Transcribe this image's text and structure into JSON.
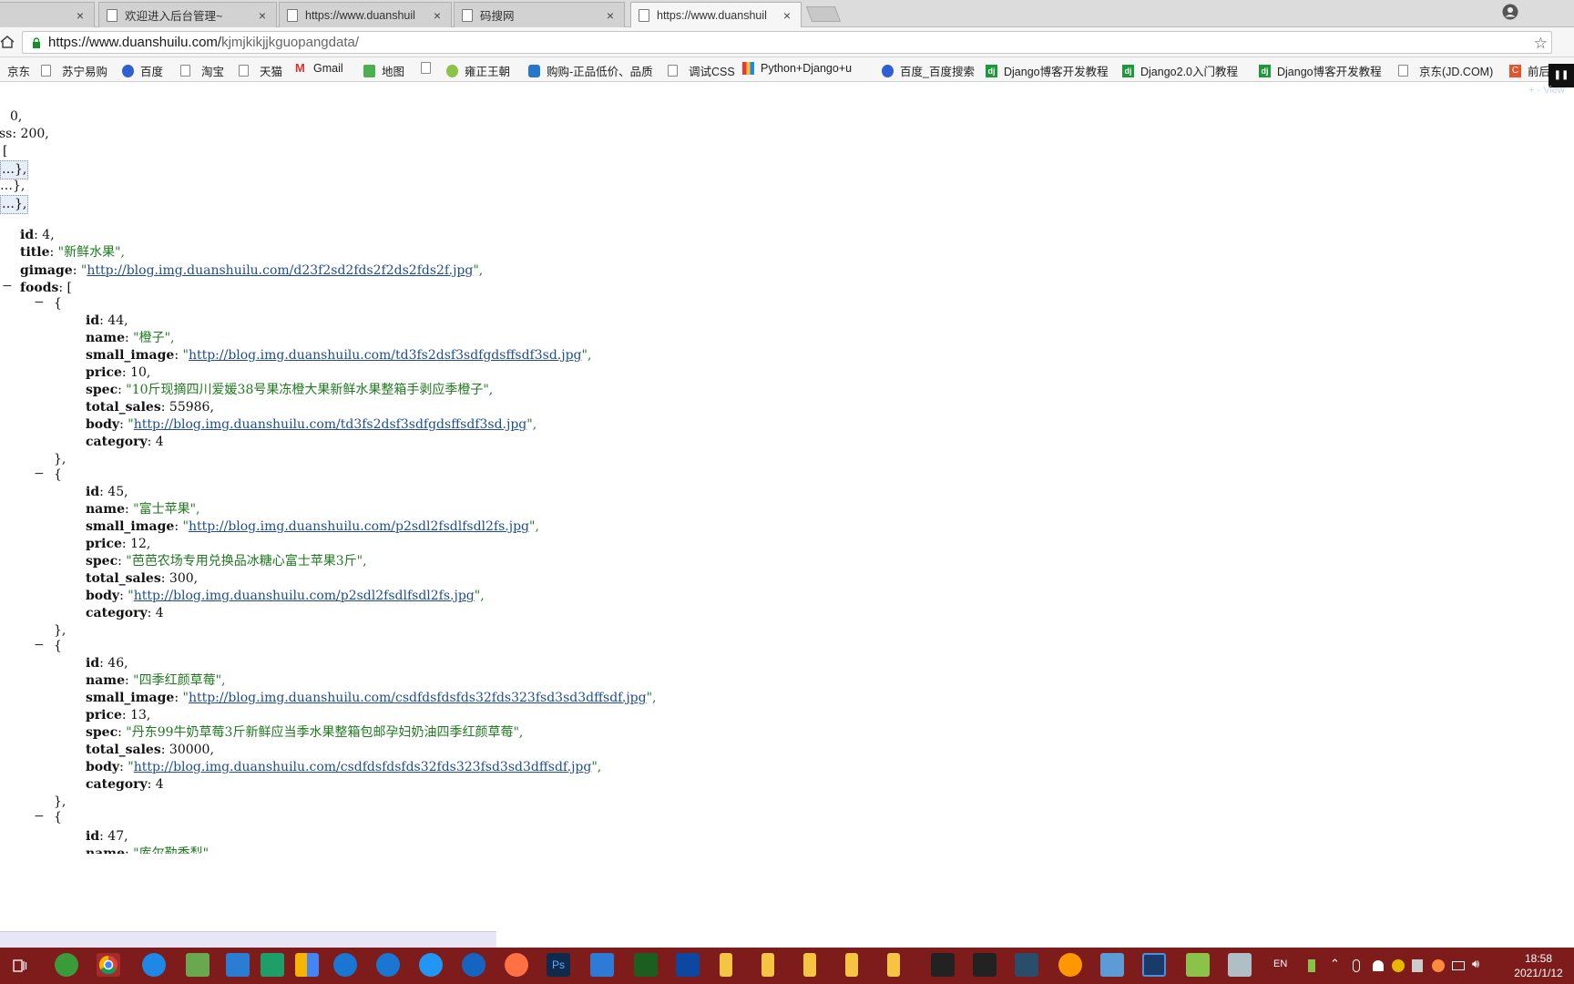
{
  "tabs": [
    {
      "title": "",
      "close": "×"
    },
    {
      "title": "欢迎进入后台管理~",
      "close": "×"
    },
    {
      "title": "https://www.duanshuil",
      "close": "×"
    },
    {
      "title": "码搜网",
      "close": "×"
    },
    {
      "title": "https://www.duanshuil",
      "close": "×"
    }
  ],
  "address": {
    "host": "https://www.duanshuilu.com/",
    "path": "kjmjkikjjkguopangdata/",
    "star": "☆"
  },
  "bookmarks": [
    "京东",
    "苏宁易购",
    "百度",
    "淘宝",
    "天猫",
    "Gmail",
    "地图",
    "",
    "雍正王朝",
    "购购-正品低价、品质",
    "调试CSS",
    "Python+Django+u",
    "百度_百度搜索",
    "Django博客开发教程",
    "Django2.0入门教程",
    "Django博客开发教程",
    "京东(JD.COM)",
    "前后"
  ],
  "view_link": "+ - View",
  "json_view": {
    "top_lines": [
      "0,",
      "ss: 200,",
      "[",
      "…},",
      "…},",
      "…},"
    ],
    "category": {
      "id": "4,",
      "title": "\"新鲜水果\",",
      "gimage": "http://blog.img.duanshuilu.com/d23f2sd2fds2f2ds2fds2f.jpg",
      "foods_open": "["
    },
    "foods": [
      {
        "id": "44,",
        "name": "\"橙子\",",
        "small_image": "http://blog.img.duanshuilu.com/td3fs2dsf3sdfgdsffsdf3sd.jpg",
        "price": "10,",
        "spec": "\"10斤现摘四川爱媛38号果冻橙大果新鲜水果整箱手剥应季橙子\",",
        "total_sales": "55986,",
        "body": "http://blog.img.duanshuilu.com/td3fs2dsf3sdfgdsffsdf3sd.jpg",
        "category": "4"
      },
      {
        "id": "45,",
        "name": "\"富士苹果\",",
        "small_image": "http://blog.img.duanshuilu.com/p2sdl2fsdlfsdl2fs.jpg",
        "price": "12,",
        "spec": "\"芭芭农场专用兑换品冰糖心富士苹果3斤\",",
        "total_sales": "300,",
        "body": "http://blog.img.duanshuilu.com/p2sdl2fsdlfsdl2fs.jpg",
        "category": "4"
      },
      {
        "id": "46,",
        "name": "\"四季红颜草莓\",",
        "small_image": "http://blog.img.duanshuilu.com/csdfdsfdsfds32fds323fsd3sd3dffsdf.jpg",
        "price": "13,",
        "spec": "\"丹东99牛奶草莓3斤新鲜应当季水果整箱包邮孕妇奶油四季红颜草莓\",",
        "total_sales": "30000,",
        "body": "http://blog.img.duanshuilu.com/csdfdsfdsfds32fds323fsd3sd3dffsdf.jpg",
        "category": "4"
      }
    ],
    "last_id": "47,",
    "last_name": "\"库尔勒香梨\"",
    "keys": {
      "id": "id",
      "title": "title",
      "gimage": "gimage",
      "foods": "foods",
      "name": "name",
      "small_image": "small_image",
      "price": "price",
      "spec": "spec",
      "total_sales": "total_sales",
      "body": "body",
      "category": "category"
    },
    "close_obj": "},",
    "open_obj": "{",
    "toggle": "−"
  },
  "taskbar": {
    "lang": "EN",
    "time": "18:58",
    "date": "2021/1/12"
  },
  "colors": {
    "taskbar": "#7e1b1b",
    "json_string": "#1f7a1f",
    "json_link": "#1f4d8c"
  }
}
